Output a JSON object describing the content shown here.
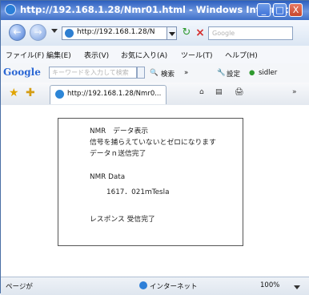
{
  "window": {
    "title": "http://192.168.1.28/Nmr01.html - Windows Internet ...",
    "buttons": {
      "minimize": "_",
      "maximize": "□",
      "close": "X"
    }
  },
  "address_bar": {
    "url": "http://192.168.1.28/N",
    "search_placeholder": "Google"
  },
  "menu": {
    "items": [
      "ファイル(F)",
      "編集(E)",
      "表示(V)",
      "お気に入り(A)",
      "ツール(T)",
      "ヘルプ(H)"
    ]
  },
  "google_toolbar": {
    "logo": "Google",
    "input_placeholder": "キーワードを入力して検索",
    "search_label": "検索",
    "more_label": "»",
    "settings_label": "設定",
    "user_label": "sidler"
  },
  "favorites_bar": {
    "tab_title": "http://192.168.1.28/Nmr0..."
  },
  "page": {
    "lines": [
      "NMR　データ表示",
      "信号を捕らえていないとゼロになります",
      "データｎ送信完了",
      "NMR Data",
      "1617．021ｍTesla",
      "レスポンス 受信完了"
    ]
  },
  "status_bar": {
    "left_text": "ページが",
    "zone_text": "インターネット",
    "zoom_text": "100%"
  },
  "colors": {
    "title_bar": "#3f6fc7",
    "close_button": "#c8472b",
    "page_background": "#ffffff"
  }
}
